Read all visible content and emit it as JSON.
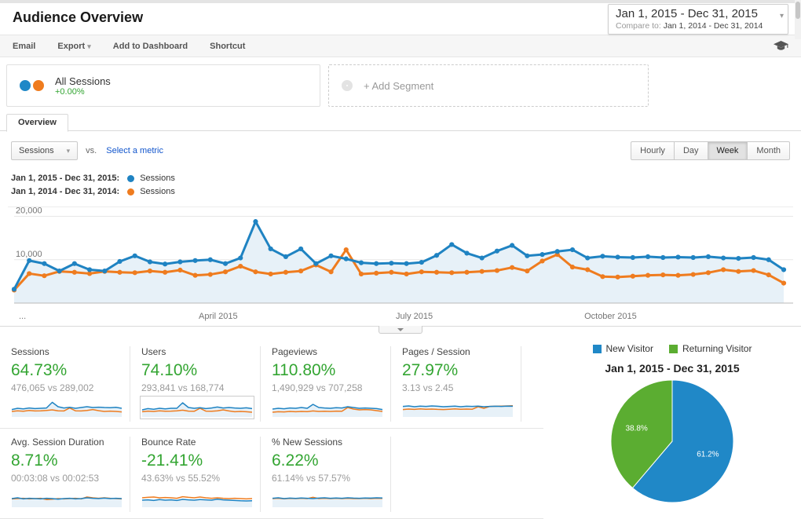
{
  "header": {
    "title": "Audience Overview",
    "date_range": "Jan 1, 2015 - Dec 31, 2015",
    "compare_label": "Compare to:",
    "compare_range": "Jan 1, 2014 - Dec 31, 2014"
  },
  "toolbar": {
    "email": "Email",
    "export": "Export",
    "add_to_dashboard": "Add to Dashboard",
    "shortcut": "Shortcut"
  },
  "segments": {
    "all_sessions": {
      "label": "All Sessions",
      "delta": "+0.00%"
    },
    "add_segment_label": "+ Add Segment"
  },
  "tabs": {
    "overview": "Overview"
  },
  "controls": {
    "metric_selector": "Sessions",
    "vs_label": "vs.",
    "select_metric_label": "Select a metric",
    "granularity": [
      "Hourly",
      "Day",
      "Week",
      "Month"
    ],
    "granularity_active": "Week"
  },
  "legend": [
    {
      "range": "Jan 1, 2015 - Dec 31, 2015:",
      "series": "Sessions",
      "color": "#1f83c2"
    },
    {
      "range": "Jan 1, 2014 - Dec 31, 2014:",
      "series": "Sessions",
      "color": "#ef7c1f"
    }
  ],
  "chart_data": [
    {
      "type": "line",
      "title": "Sessions by week, 2015 vs 2014",
      "ylim": [
        0,
        21000
      ],
      "y_ticks": [
        {
          "value": 10000,
          "label": "10,000"
        },
        {
          "value": 20000,
          "label": "20,000"
        }
      ],
      "x_axis_labels": [
        "...",
        "April 2015",
        "July 2015",
        "October 2015"
      ],
      "x_label_indices": [
        0,
        13,
        26,
        39
      ],
      "grid": true,
      "legend_position": "top-left",
      "series": [
        {
          "name": "Sessions (Jan 1, 2015 - Dec 31, 2015)",
          "color": "#1f83c2",
          "values": [
            3200,
            9800,
            9100,
            7400,
            9100,
            7700,
            7400,
            9600,
            10900,
            9500,
            9000,
            9500,
            9800,
            10000,
            9100,
            10400,
            18800,
            12500,
            10700,
            12500,
            9100,
            10900,
            10200,
            9300,
            9100,
            9200,
            9100,
            9400,
            11000,
            13500,
            11500,
            10400,
            12000,
            13300,
            10900,
            11200,
            11900,
            12300,
            10400,
            10800,
            10600,
            10500,
            10700,
            10500,
            10600,
            10500,
            10700,
            10400,
            10300,
            10500,
            10000,
            7700
          ]
        },
        {
          "name": "Sessions (Jan 1, 2014 - Dec 31, 2014)",
          "color": "#ef7c1f",
          "values": [
            3000,
            6800,
            6300,
            7300,
            7100,
            6800,
            7300,
            7100,
            7000,
            7400,
            7100,
            7600,
            6400,
            6600,
            7200,
            8500,
            7200,
            6700,
            7100,
            7400,
            8800,
            7200,
            12300,
            6700,
            6900,
            7100,
            6700,
            7200,
            7100,
            7000,
            7100,
            7300,
            7500,
            8200,
            7400,
            9700,
            11200,
            8300,
            7700,
            6100,
            6000,
            6200,
            6400,
            6500,
            6400,
            6600,
            7000,
            7700,
            7300,
            7500,
            6500,
            4600
          ]
        }
      ]
    },
    {
      "type": "pie",
      "title": "Jan 1, 2015 - Dec 31, 2015",
      "legend_position": "top",
      "slices": [
        {
          "label": "New Visitor",
          "value": 61.2,
          "display": "61.2%",
          "color": "#2088c7"
        },
        {
          "label": "Returning Visitor",
          "value": 38.8,
          "display": "38.8%",
          "color": "#5bad31"
        }
      ]
    }
  ],
  "metrics": {
    "rows": [
      [
        {
          "label": "Sessions",
          "delta": "64.73%",
          "comparison": "476,065 vs 289,002",
          "highlighted": false,
          "spark": {
            "s2015": [
              0.42,
              0.5,
              0.46,
              0.52,
              0.48,
              0.5,
              0.52,
              0.88,
              0.6,
              0.52,
              0.56,
              0.5,
              0.55,
              0.6,
              0.55,
              0.57,
              0.55,
              0.54,
              0.56,
              0.5
            ],
            "s2014": [
              0.3,
              0.34,
              0.31,
              0.36,
              0.33,
              0.34,
              0.36,
              0.4,
              0.34,
              0.33,
              0.52,
              0.34,
              0.33,
              0.36,
              0.42,
              0.35,
              0.3,
              0.32,
              0.3,
              0.27
            ]
          }
        },
        {
          "label": "Users",
          "delta": "74.10%",
          "comparison": "293,841 vs 168,774",
          "highlighted": true,
          "spark": {
            "s2015": [
              0.4,
              0.48,
              0.44,
              0.5,
              0.46,
              0.5,
              0.5,
              0.85,
              0.55,
              0.5,
              0.54,
              0.48,
              0.52,
              0.58,
              0.52,
              0.55,
              0.52,
              0.5,
              0.53,
              0.48
            ],
            "s2014": [
              0.28,
              0.32,
              0.3,
              0.34,
              0.31,
              0.32,
              0.34,
              0.38,
              0.32,
              0.31,
              0.5,
              0.32,
              0.31,
              0.34,
              0.4,
              0.33,
              0.28,
              0.3,
              0.28,
              0.25
            ]
          }
        },
        {
          "label": "Pageviews",
          "delta": "110.80%",
          "comparison": "1,490,929 vs 707,258",
          "highlighted": false,
          "spark": {
            "s2015": [
              0.45,
              0.5,
              0.47,
              0.52,
              0.5,
              0.55,
              0.5,
              0.75,
              0.55,
              0.52,
              0.5,
              0.54,
              0.52,
              0.6,
              0.55,
              0.5,
              0.52,
              0.5,
              0.48,
              0.42
            ],
            "s2014": [
              0.25,
              0.28,
              0.27,
              0.3,
              0.28,
              0.3,
              0.29,
              0.33,
              0.3,
              0.31,
              0.3,
              0.32,
              0.31,
              0.55,
              0.45,
              0.4,
              0.42,
              0.4,
              0.35,
              0.3
            ]
          }
        },
        {
          "label": "Pages / Session",
          "delta": "27.97%",
          "comparison": "3.13 vs 2.45",
          "highlighted": false,
          "spark": {
            "s2015": [
              0.62,
              0.65,
              0.6,
              0.64,
              0.62,
              0.65,
              0.63,
              0.6,
              0.62,
              0.64,
              0.6,
              0.63,
              0.62,
              0.64,
              0.6,
              0.62,
              0.63,
              0.62,
              0.64,
              0.63
            ],
            "s2014": [
              0.42,
              0.45,
              0.43,
              0.46,
              0.44,
              0.45,
              0.43,
              0.42,
              0.44,
              0.46,
              0.44,
              0.45,
              0.44,
              0.6,
              0.5,
              0.62,
              0.63,
              0.64,
              0.65,
              0.66
            ]
          }
        }
      ],
      [
        {
          "label": "Avg. Session Duration",
          "delta": "8.71%",
          "comparison": "00:03:08 vs 00:02:53",
          "highlighted": false,
          "spark": {
            "s2015": [
              0.5,
              0.55,
              0.48,
              0.52,
              0.5,
              0.48,
              0.52,
              0.5,
              0.46,
              0.5,
              0.52,
              0.48,
              0.5,
              0.55,
              0.52,
              0.5,
              0.53,
              0.5,
              0.52,
              0.5
            ],
            "s2014": [
              0.48,
              0.5,
              0.52,
              0.48,
              0.5,
              0.52,
              0.44,
              0.46,
              0.5,
              0.48,
              0.5,
              0.52,
              0.48,
              0.6,
              0.55,
              0.52,
              0.55,
              0.52,
              0.5,
              0.48
            ]
          }
        },
        {
          "label": "Bounce Rate",
          "delta": "-21.41%",
          "comparison": "43.63% vs 55.52%",
          "highlighted": false,
          "spark": {
            "s2015": [
              0.4,
              0.42,
              0.38,
              0.44,
              0.4,
              0.42,
              0.38,
              0.45,
              0.42,
              0.4,
              0.44,
              0.42,
              0.4,
              0.46,
              0.42,
              0.4,
              0.38,
              0.36,
              0.35,
              0.36
            ],
            "s2014": [
              0.55,
              0.58,
              0.6,
              0.55,
              0.57,
              0.55,
              0.52,
              0.62,
              0.58,
              0.55,
              0.6,
              0.55,
              0.52,
              0.55,
              0.52,
              0.5,
              0.52,
              0.5,
              0.48,
              0.5
            ]
          }
        },
        {
          "label": "% New Sessions",
          "delta": "6.22%",
          "comparison": "61.14% vs 57.57%",
          "highlighted": false,
          "spark": {
            "s2015": [
              0.52,
              0.55,
              0.5,
              0.53,
              0.51,
              0.54,
              0.52,
              0.5,
              0.53,
              0.55,
              0.52,
              0.54,
              0.52,
              0.55,
              0.53,
              0.52,
              0.54,
              0.53,
              0.55,
              0.54
            ],
            "s2014": [
              0.5,
              0.52,
              0.49,
              0.51,
              0.5,
              0.52,
              0.5,
              0.58,
              0.5,
              0.52,
              0.5,
              0.52,
              0.5,
              0.52,
              0.5,
              0.5,
              0.52,
              0.5,
              0.52,
              0.51
            ]
          }
        }
      ]
    ]
  },
  "colors": {
    "positive_green": "#33a532",
    "link_blue": "#1155cc",
    "line_blue": "#1f83c2",
    "line_orange": "#ef7c1f",
    "area_fill": "#e7f1f8"
  }
}
